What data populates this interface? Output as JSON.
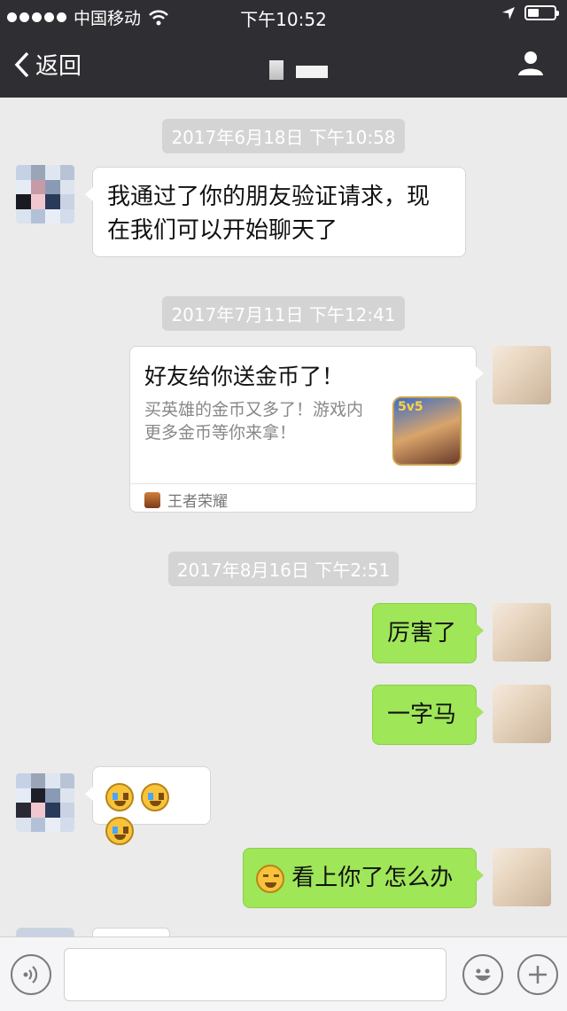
{
  "status_bar": {
    "carrier": "中国移动",
    "time": "下午10:52"
  },
  "nav": {
    "back_label": "返回"
  },
  "timestamps": [
    "2017年6月18日 下午10:58",
    "2017年7月11日 下午12:41",
    "2017年8月16日 下午2:51"
  ],
  "messages": {
    "m1": "我通过了你的朋友验证请求，现在我们可以开始聊天了",
    "card": {
      "title": "好友给你送金币了！",
      "desc": "买英雄的金币又多了！游戏内更多金币等你来拿！",
      "thumb_badge": "5v5",
      "source": "王者荣耀"
    },
    "m3": "厉害了",
    "m4": "一字马",
    "m6": "看上你了怎么办"
  },
  "colors": {
    "nav_bg": "#2f2f33",
    "chat_bg": "#ebebeb",
    "out_bubble": "#9fe658",
    "timestamp_bg": "#d4d4d4"
  }
}
